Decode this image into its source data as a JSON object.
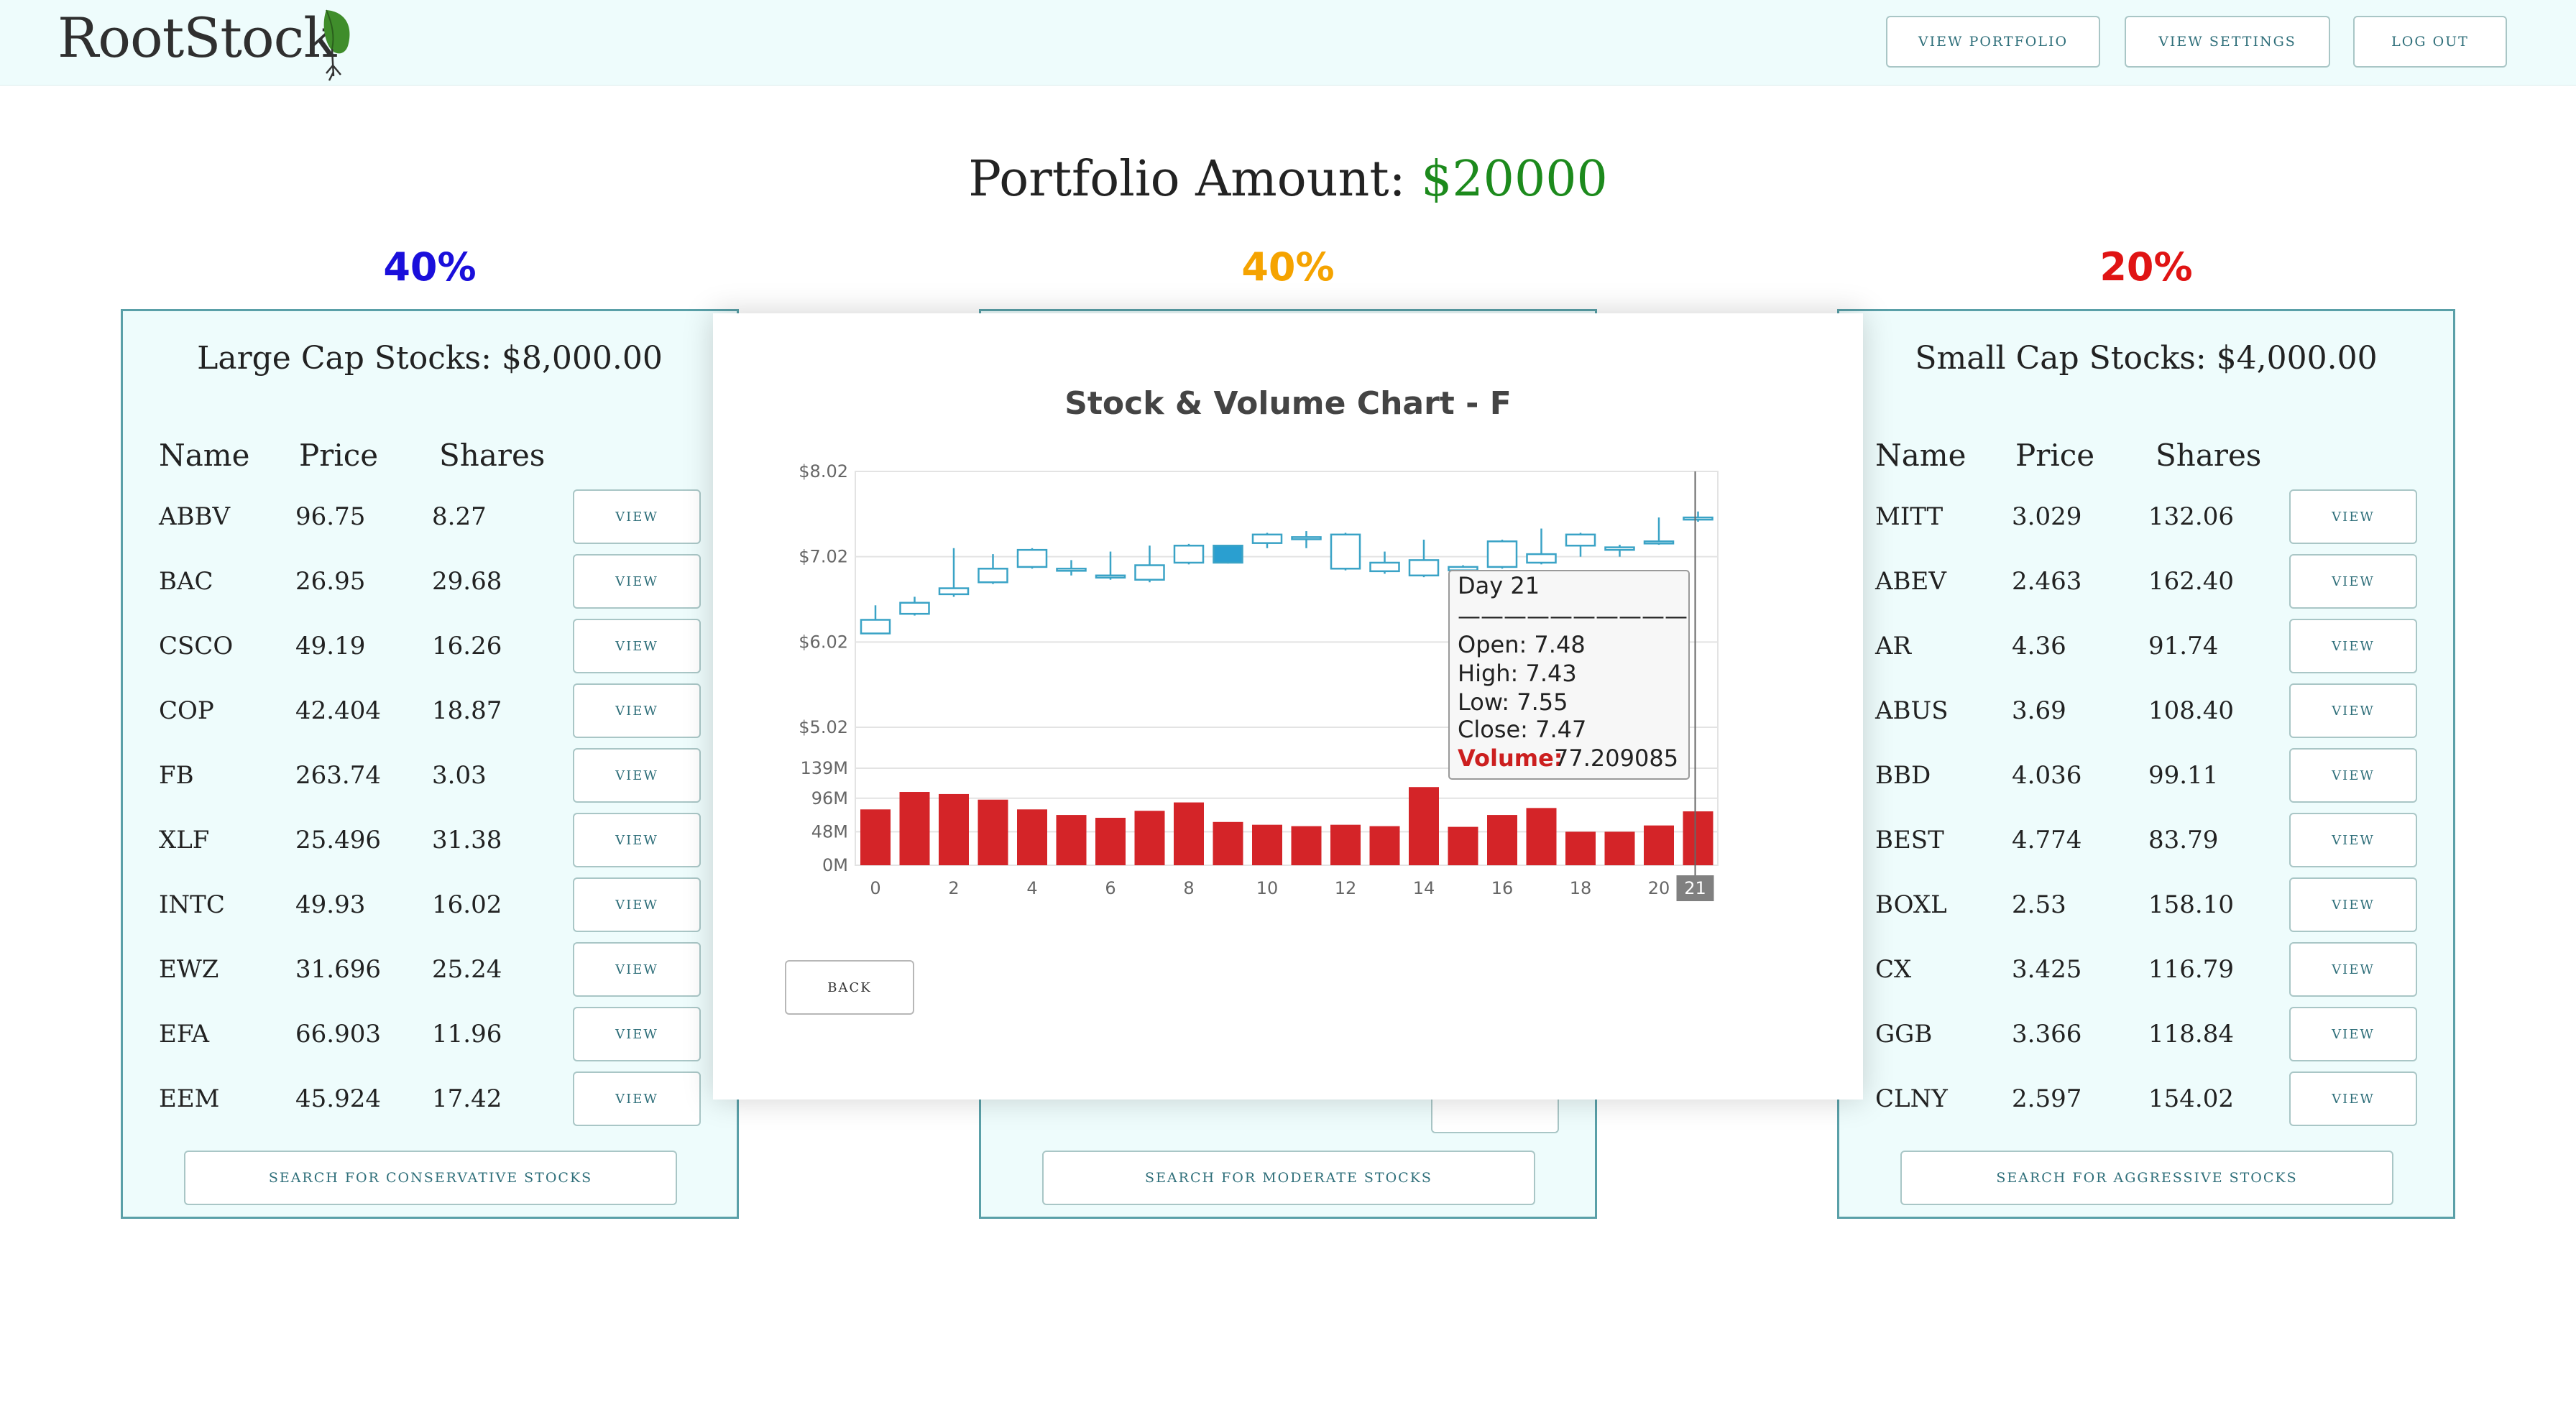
{
  "header": {
    "logo": "RootStock",
    "buttons": [
      "VIEW PORTFOLIO",
      "VIEW SETTINGS",
      "LOG OUT"
    ]
  },
  "portfolio": {
    "label": "Portfolio Amount:",
    "amount": "$20000"
  },
  "allocations": [
    {
      "pct": "40%",
      "color": "#1a0fdb"
    },
    {
      "pct": "40%",
      "color": "#f5a300"
    },
    {
      "pct": "20%",
      "color": "#e01414"
    }
  ],
  "panels": {
    "large": {
      "title": "Large Cap Stocks: $8,000.00",
      "columns": [
        "Name",
        "Price",
        "Shares"
      ],
      "rows": [
        [
          "ABBV",
          "96.75",
          "8.27"
        ],
        [
          "BAC",
          "26.95",
          "29.68"
        ],
        [
          "CSCO",
          "49.19",
          "16.26"
        ],
        [
          "COP",
          "42.404",
          "18.87"
        ],
        [
          "FB",
          "263.74",
          "3.03"
        ],
        [
          "XLF",
          "25.496",
          "31.38"
        ],
        [
          "INTC",
          "49.93",
          "16.02"
        ],
        [
          "EWZ",
          "31.696",
          "25.24"
        ],
        [
          "EFA",
          "66.903",
          "11.96"
        ],
        [
          "EEM",
          "45.924",
          "17.42"
        ]
      ],
      "view_label": "VIEW",
      "search_label": "SEARCH FOR CONSERVATIVE STOCKS"
    },
    "medium": {
      "search_label": "SEARCH FOR MODERATE STOCKS"
    },
    "small": {
      "title": "Small Cap Stocks: $4,000.00",
      "columns": [
        "Name",
        "Price",
        "Shares"
      ],
      "rows": [
        [
          "MITT",
          "3.029",
          "132.06"
        ],
        [
          "ABEV",
          "2.463",
          "162.40"
        ],
        [
          "AR",
          "4.36",
          "91.74"
        ],
        [
          "ABUS",
          "3.69",
          "108.40"
        ],
        [
          "BBD",
          "4.036",
          "99.11"
        ],
        [
          "BEST",
          "4.774",
          "83.79"
        ],
        [
          "BOXL",
          "2.53",
          "158.10"
        ],
        [
          "CX",
          "3.425",
          "116.79"
        ],
        [
          "GGB",
          "3.366",
          "118.84"
        ],
        [
          "CLNY",
          "2.597",
          "154.02"
        ]
      ],
      "view_label": "VIEW",
      "search_label": "SEARCH FOR AGGRESSIVE STOCKS"
    }
  },
  "modal": {
    "back_label": "BACK"
  },
  "chart_data": {
    "type": "candlestick+bar",
    "title": "Stock & Volume Chart - F",
    "x": [
      0,
      1,
      2,
      3,
      4,
      5,
      6,
      7,
      8,
      9,
      10,
      11,
      12,
      13,
      14,
      15,
      16,
      17,
      18,
      19,
      20,
      21
    ],
    "x_ticks": [
      "0",
      "2",
      "4",
      "6",
      "8",
      "10",
      "12",
      "14",
      "16",
      "18",
      "20",
      "21"
    ],
    "price_ticks": [
      "$8.02",
      "$7.02",
      "$6.02",
      "$5.02"
    ],
    "volume_ticks": [
      "139M",
      "96M",
      "48M",
      "0M"
    ],
    "price_ylim": [
      5.02,
      8.02
    ],
    "volume_ylim": [
      0,
      139
    ],
    "candles": [
      {
        "open": 6.12,
        "close": 6.28,
        "high": 6.45,
        "low": 6.12
      },
      {
        "open": 6.35,
        "close": 6.48,
        "high": 6.55,
        "low": 6.33
      },
      {
        "open": 6.58,
        "close": 6.65,
        "high": 7.12,
        "low": 6.55
      },
      {
        "open": 6.72,
        "close": 6.88,
        "high": 7.05,
        "low": 6.7
      },
      {
        "open": 6.9,
        "close": 7.1,
        "high": 7.12,
        "low": 6.88
      },
      {
        "open": 6.86,
        "close": 6.88,
        "high": 6.98,
        "low": 6.8
      },
      {
        "open": 6.78,
        "close": 6.8,
        "high": 7.08,
        "low": 6.75
      },
      {
        "open": 6.75,
        "close": 6.92,
        "high": 7.15,
        "low": 6.72
      },
      {
        "open": 6.95,
        "close": 7.15,
        "high": 7.17,
        "low": 6.93
      },
      {
        "open": 7.15,
        "close": 6.95,
        "high": 7.16,
        "low": 6.94
      },
      {
        "open": 7.18,
        "close": 7.28,
        "high": 7.3,
        "low": 7.12
      },
      {
        "open": 7.23,
        "close": 7.25,
        "high": 7.32,
        "low": 7.12
      },
      {
        "open": 6.88,
        "close": 7.28,
        "high": 7.3,
        "low": 6.86
      },
      {
        "open": 6.85,
        "close": 6.95,
        "high": 7.08,
        "low": 6.82
      },
      {
        "open": 6.8,
        "close": 6.98,
        "high": 7.22,
        "low": 6.78
      },
      {
        "open": 6.86,
        "close": 6.9,
        "high": 6.92,
        "low": 6.84
      },
      {
        "open": 6.9,
        "close": 7.2,
        "high": 7.22,
        "low": 6.88
      },
      {
        "open": 6.95,
        "close": 7.05,
        "high": 7.35,
        "low": 6.93
      },
      {
        "open": 7.15,
        "close": 7.28,
        "high": 7.3,
        "low": 7.02
      },
      {
        "open": 7.1,
        "close": 7.13,
        "high": 7.16,
        "low": 7.02
      },
      {
        "open": 7.18,
        "close": 7.2,
        "high": 7.48,
        "low": 7.16
      },
      {
        "open": 7.48,
        "close": 7.47,
        "high": 7.55,
        "low": 7.43
      }
    ],
    "volume": [
      80,
      105,
      102,
      94,
      80,
      72,
      68,
      78,
      90,
      62,
      58,
      56,
      58,
      56,
      112,
      55,
      72,
      82,
      48,
      48,
      57,
      77.2
    ],
    "tooltip": {
      "title": "Day 21",
      "separator": "——————————",
      "open": "Open: 7.48",
      "high": "High: 7.43",
      "low": "Low: 7.55",
      "close": "Close: 7.47",
      "volume_label": "Volume:",
      "volume_value": "77.209085"
    },
    "colors": {
      "candle": "#3aa3c6",
      "volume": "#d42428",
      "highlight": "#2a9fd0"
    }
  }
}
